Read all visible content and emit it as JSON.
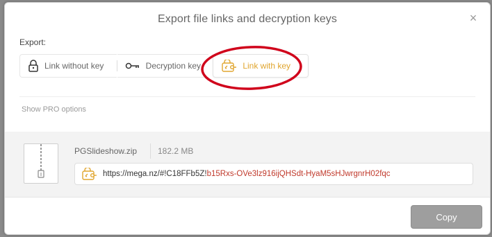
{
  "dialog": {
    "title": "Export file links and decryption keys",
    "close_symbol": "×"
  },
  "export": {
    "label": "Export:",
    "tabs": [
      {
        "label": "Link without key",
        "icon": "lock-icon"
      },
      {
        "label": "Decryption key",
        "icon": "key-icon"
      },
      {
        "label": "Link with key",
        "icon": "link-key-icon",
        "active": true
      }
    ]
  },
  "pro_options": {
    "label": "Show PRO options"
  },
  "file": {
    "name": "PGSlideshow.zip",
    "size": "182.2 MB",
    "icon": "zip-file-icon",
    "link_base": "https://mega.nz/#!C18FFb5Z!",
    "link_key": "b15Rxs-OVe3lz916ijQHSdt-HyaM5sHJwrgnrH02fqc"
  },
  "footer": {
    "copy_label": "Copy"
  },
  "colors": {
    "accent": "#e0a52e",
    "key_text": "#c0392b",
    "annotation": "#d0021b"
  }
}
